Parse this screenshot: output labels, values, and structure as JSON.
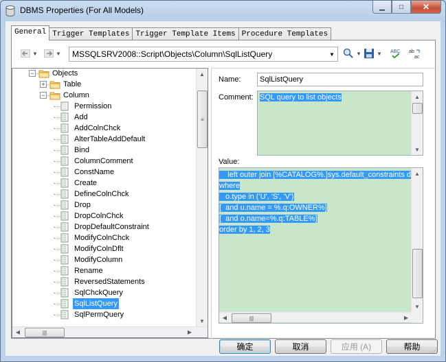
{
  "window": {
    "title": "DBMS Properties (For All Models)",
    "minimize_glyph": "▁",
    "maximize_glyph": "□",
    "close_glyph": "✕"
  },
  "tabs": [
    "General",
    "Trigger Templates",
    "Trigger Template Items",
    "Procedure Templates"
  ],
  "toolbar": {
    "path": "MSSQLSRV2008::Script\\Objects\\Column\\SqlListQuery",
    "icons": [
      "back-arrow-icon",
      "forward-arrow-icon",
      "find-icon",
      "save-icon",
      "spellcheck-icon",
      "replace-text-icon"
    ]
  },
  "tree": {
    "nodes": [
      {
        "label": "Objects",
        "type": "folder",
        "state": "expanded"
      },
      {
        "label": "Table",
        "type": "folder",
        "state": "collapsed"
      },
      {
        "label": "Column",
        "type": "folder",
        "state": "expanded"
      },
      {
        "label": "Permission",
        "type": "item"
      },
      {
        "label": "Add",
        "type": "item"
      },
      {
        "label": "AddColnChck",
        "type": "item"
      },
      {
        "label": "AlterTableAddDefault",
        "type": "item"
      },
      {
        "label": "Bind",
        "type": "item"
      },
      {
        "label": "ColumnComment",
        "type": "item"
      },
      {
        "label": "ConstName",
        "type": "item"
      },
      {
        "label": "Create",
        "type": "item"
      },
      {
        "label": "DefineColnChck",
        "type": "item"
      },
      {
        "label": "Drop",
        "type": "item"
      },
      {
        "label": "DropColnChck",
        "type": "item"
      },
      {
        "label": "DropDefaultConstraint",
        "type": "item"
      },
      {
        "label": "ModifyColnChck",
        "type": "item"
      },
      {
        "label": "ModifyColnDflt",
        "type": "item"
      },
      {
        "label": "ModifyColumn",
        "type": "item"
      },
      {
        "label": "Rename",
        "type": "item"
      },
      {
        "label": "ReversedStatements",
        "type": "item"
      },
      {
        "label": "SqlChckQuery",
        "type": "item"
      },
      {
        "label": "SqlListQuery",
        "type": "item",
        "selected": true
      },
      {
        "label": "SqlPermQuery",
        "type": "item"
      }
    ]
  },
  "details": {
    "name_label": "Name:",
    "name_value": "SqlListQuery",
    "comment_label": "Comment:",
    "comment_value": "SQL query to list objects",
    "value_label": "Value:",
    "value_lines": [
      "    left outer join [%CATALOG%.]sys.default_constraints d on",
      "where",
      "   o.type in ('U', 'S', 'V')",
      "[  and u.name = %.q:OWNER%]",
      "[  and o.name=%.q:TABLE%]",
      "order by 1, 2, 3"
    ]
  },
  "buttons": {
    "ok": "确定",
    "cancel": "取消",
    "apply": "应用 (A)",
    "help": "帮助"
  },
  "colors": {
    "selection": "#3399ff",
    "editor_background": "#c8e6c9"
  }
}
